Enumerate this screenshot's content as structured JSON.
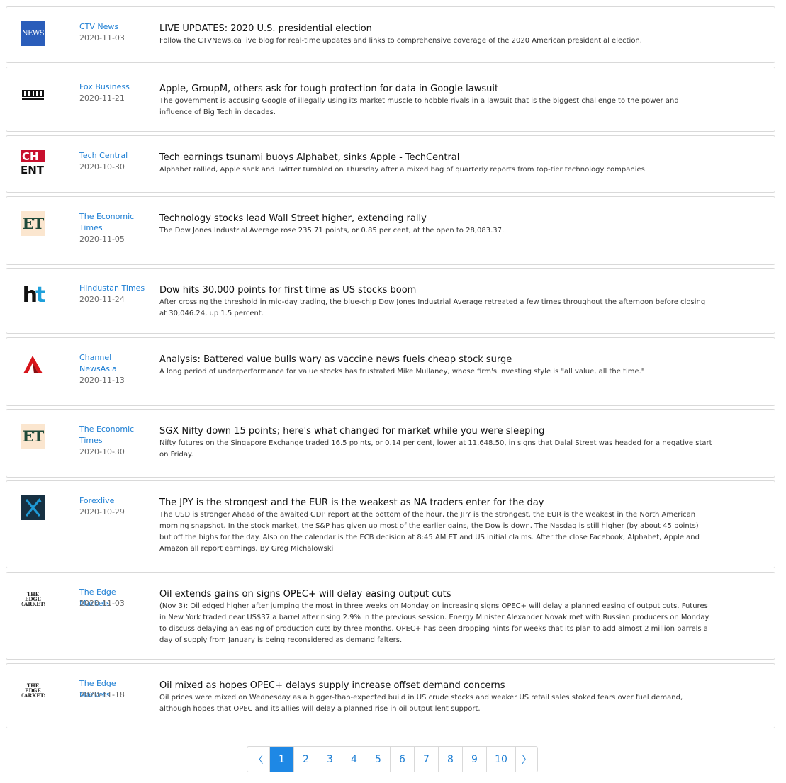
{
  "articles": [
    {
      "source": "CTV News",
      "date": "2020-11-03",
      "title": "LIVE UPDATES: 2020 U.S. presidential election",
      "description": "Follow the CTVNews.ca live blog for real-time updates and links to comprehensive coverage of the 2020 American presidential election.",
      "logo_text": "NEWS"
    },
    {
      "source": "Fox Business",
      "date": "2020-11-21",
      "title": "Apple, GroupM, others ask for tough protection for data in Google lawsuit",
      "description": "The government is accusing Google of illegally using its market muscle to hobble rivals in a lawsuit that is the biggest challenge to the power and influence of Big Tech in decades.",
      "logo_text": "FOX"
    },
    {
      "source": "Tech Central",
      "date": "2020-10-30",
      "title": "Tech earnings tsunami buoys Alphabet, sinks Apple - TechCentral",
      "description": "Alphabet rallied, Apple sank and Twitter tumbled on Thursday after a mixed bag of quarterly reports from top-tier technology companies.",
      "logo_text": "CH"
    },
    {
      "source": "The Economic Times",
      "date": "2020-11-05",
      "title": "Technology stocks lead Wall Street higher, extending rally",
      "description": "The Dow Jones Industrial Average rose 235.71 points, or 0.85 per cent, at the open to 28,083.37.",
      "logo_text": "ET"
    },
    {
      "source": "Hindustan Times",
      "date": "2020-11-24",
      "title": "Dow hits 30,000 points for first time as US stocks boom",
      "description": "After crossing the threshold in mid-day trading, the blue-chip Dow Jones Industrial Average retreated a few times throughout the afternoon before closing at 30,046.24, up 1.5 percent.",
      "logo_text": "ht"
    },
    {
      "source": "Channel NewsAsia",
      "date": "2020-11-13",
      "title": "Analysis: Battered value bulls wary as vaccine news fuels cheap stock surge",
      "description": "A long period of underperformance for value stocks has frustrated Mike Mullaney, whose firm's investing style is \"all value, all the time.\"",
      "logo_text": ""
    },
    {
      "source": "The Economic Times",
      "date": "2020-10-30",
      "title": "SGX Nifty down 15 points; here's what changed for market while you were sleeping",
      "description": "Nifty futures on the Singapore Exchange traded 16.5 points, or 0.14 per cent, lower at 11,648.50, in signs that Dalal Street was headed for a negative start on Friday.",
      "logo_text": "ET"
    },
    {
      "source": "Forexlive",
      "date": "2020-10-29",
      "title": "The JPY is the strongest and the EUR is the weakest as NA traders enter for the day",
      "description": "The USD is stronger Ahead of the awaited GDP report at the bottom of the hour, the JPY is the strongest, the EUR is the weakest in the North American morning snapshot. In the stock market, the S&P has given up most of the earlier gains, the Dow is down. The Nasdaq is still higher (by about 45 points) but off the highs for the day. Also on the calendar is the ECB decision at 8:45 AM ET and US initial claims. After the close Facebook, Alphabet, Apple and Amazon all report earnings. By Greg Michalowski",
      "logo_text": ""
    },
    {
      "source": "The Edge Markets",
      "date": "2020-11-03",
      "title": "Oil extends gains on signs OPEC+ will delay easing output cuts",
      "description": "(Nov 3): Oil edged higher after jumping the most in three weeks on Monday on increasing signs OPEC+ will delay a planned easing of output cuts. Futures in New York traded near US$37 a barrel after rising 2.9% in the previous session. Energy Minister Alexander Novak met with Russian producers on Monday to discuss delaying an easing of production cuts by three months. OPEC+ has been dropping hints for weeks that its plan to add almost 2 million barrels a day of supply from January is being reconsidered as demand falters.",
      "logo_text": "THE EDGE MARKETS"
    },
    {
      "source": "The Edge Markets",
      "date": "2020-11-18",
      "title": "Oil mixed as hopes OPEC+ delays supply increase offset demand concerns",
      "description": "Oil prices were mixed on Wednesday as a bigger-than-expected build in US crude stocks and weaker US retail sales stoked fears over fuel demand, although hopes that OPEC and its allies will delay a planned rise in oil output lent support.",
      "logo_text": "THE EDGE MARKETS"
    }
  ],
  "pagination": {
    "prev": "〈",
    "next": "〉",
    "pages": [
      "1",
      "2",
      "3",
      "4",
      "5",
      "6",
      "7",
      "8",
      "9",
      "10"
    ],
    "current": "1"
  },
  "colors": {
    "link": "#1e7fd4",
    "active_page": "#1e88e5",
    "border": "#d9d9d9"
  }
}
